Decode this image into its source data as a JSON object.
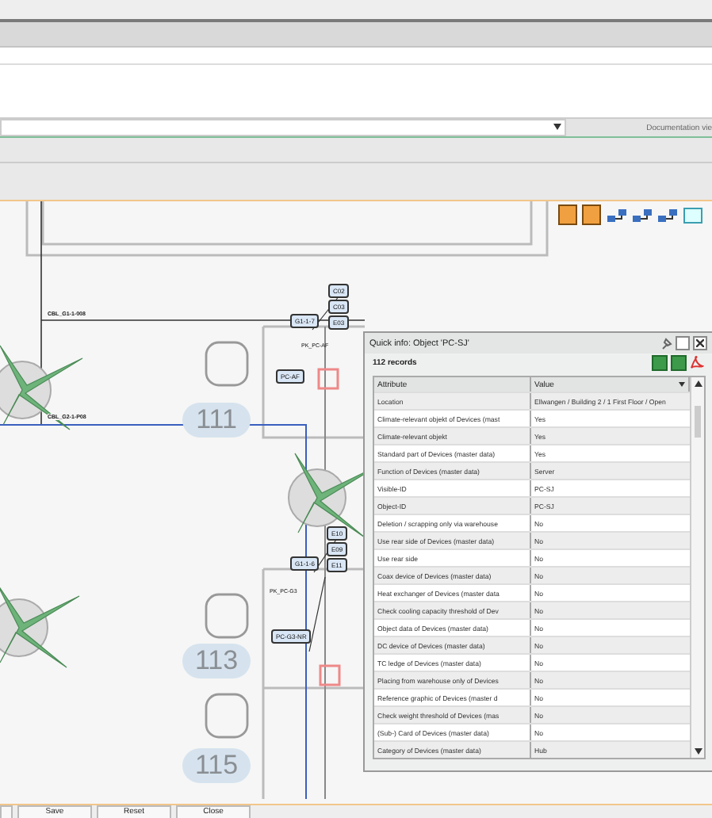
{
  "view_selector": {
    "label": "Documentation vie"
  },
  "floor_plan": {
    "cables": [
      {
        "label": "CBL_G1-1-008"
      },
      {
        "label": "CBL_G2-1-P08"
      }
    ],
    "rooms": [
      {
        "number": "111"
      },
      {
        "number": "113"
      },
      {
        "number": "115"
      }
    ],
    "devices": [
      {
        "label": "C02"
      },
      {
        "label": "C03"
      },
      {
        "label": "E03"
      },
      {
        "label": "G1-1-7"
      },
      {
        "label": "PC-AF"
      },
      {
        "label": "E10"
      },
      {
        "label": "E09"
      },
      {
        "label": "E11"
      },
      {
        "label": "G1-1-6"
      },
      {
        "label": "PC-G3-NR"
      }
    ],
    "ports": [
      {
        "label": "PK_PC-AF"
      },
      {
        "label": "PK_PC-G3"
      }
    ]
  },
  "quick_info": {
    "title": "Quick info: Object 'PC-SJ'",
    "records": "112 records",
    "columns": [
      "Attribute",
      "Value"
    ],
    "rows": [
      {
        "attribute": "Location",
        "value": "Ellwangen / Building 2 / 1 First Floor / Open"
      },
      {
        "attribute": "Climate-relevant objekt of Devices (mast",
        "value": "Yes"
      },
      {
        "attribute": "Climate-relevant objekt",
        "value": "Yes"
      },
      {
        "attribute": "Standard part of Devices (master data)",
        "value": "Yes"
      },
      {
        "attribute": "Function of Devices (master data)",
        "value": "Server"
      },
      {
        "attribute": "Visible-ID",
        "value": "PC-SJ"
      },
      {
        "attribute": "Object-ID",
        "value": "PC-SJ"
      },
      {
        "attribute": "Deletion / scrapping only via warehouse",
        "value": "No"
      },
      {
        "attribute": "Use rear side of Devices (master data)",
        "value": "No"
      },
      {
        "attribute": "Use rear side",
        "value": "No"
      },
      {
        "attribute": "Coax device of Devices (master data)",
        "value": "No"
      },
      {
        "attribute": "Heat exchanger of Devices (master data",
        "value": "No"
      },
      {
        "attribute": "Check cooling capacity threshold of Dev",
        "value": "No"
      },
      {
        "attribute": "Object data of Devices (master data)",
        "value": "No"
      },
      {
        "attribute": "DC device of Devices (master data)",
        "value": "No"
      },
      {
        "attribute": "TC ledge of Devices (master data)",
        "value": "No"
      },
      {
        "attribute": "Placing from warehouse only of Devices",
        "value": "No"
      },
      {
        "attribute": "Reference graphic of Devices (master d",
        "value": "No"
      },
      {
        "attribute": "Check weight threshold of Devices (mas",
        "value": "No"
      },
      {
        "attribute": "(Sub-) Card of Devices (master data)",
        "value": "No"
      },
      {
        "attribute": "Category of Devices (master data)",
        "value": "Hub"
      }
    ]
  },
  "buttons": [
    "Save",
    "Reset",
    "Close"
  ]
}
